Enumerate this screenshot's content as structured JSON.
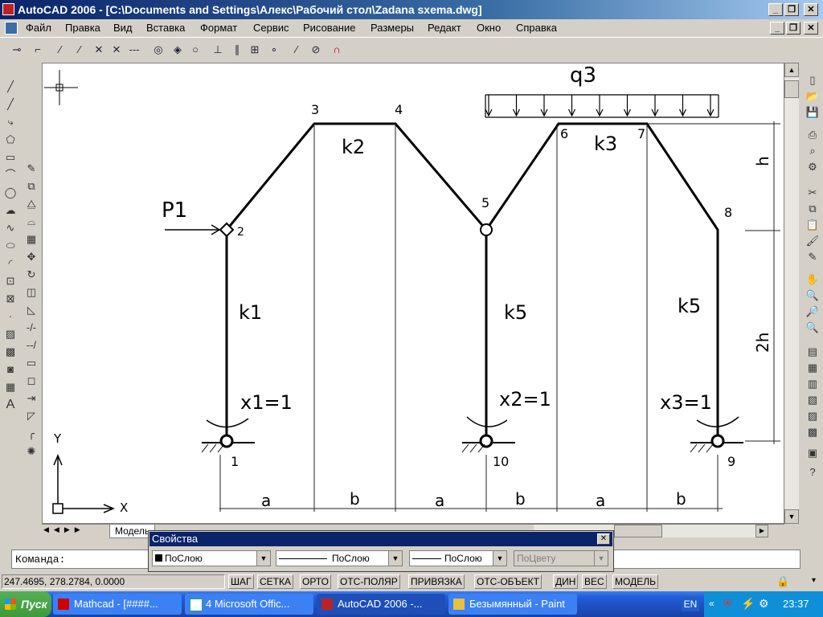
{
  "window": {
    "title": "AutoCAD 2006 - [C:\\Documents and Settings\\Алекс\\Рабочий стол\\Zadana sxema.dwg]",
    "buttons": [
      "_",
      "❐",
      "✕"
    ]
  },
  "menu": [
    "Файл",
    "Правка",
    "Вид",
    "Вставка",
    "Формат",
    "Сервис",
    "Рисование",
    "Размеры",
    "Редакт",
    "Окно",
    "Справка"
  ],
  "drawing": {
    "nodes": [
      "1",
      "2",
      "3",
      "4",
      "5",
      "6",
      "7",
      "8",
      "9",
      "10"
    ],
    "members": [
      "k1",
      "k2",
      "k3",
      "k5",
      "k5"
    ],
    "load_point": "P1",
    "load_distributed": "q3",
    "unknowns": [
      "x1=1",
      "x2=1",
      "x3=1"
    ],
    "spans": [
      "a",
      "b",
      "a",
      "b",
      "a",
      "b"
    ],
    "heights": [
      "h",
      "2h"
    ],
    "axes": {
      "x": "X",
      "y": "Y"
    }
  },
  "tabs": {
    "model": "Модель"
  },
  "command": {
    "prompt": "Команда:"
  },
  "properties": {
    "title": "Свойства",
    "color": "ПоСлою",
    "linetype": "ПоСлою",
    "lineweight": "ПоСлою",
    "plotstyle": "ПоЦвету"
  },
  "status": {
    "coords": "247.4695, 278.2784, 0.0000",
    "buttons": [
      "ШАГ",
      "СЕТКА",
      "ОРТО",
      "ОТС-ПОЛЯР",
      "ПРИВЯЗКА",
      "ОТС-ОБЪЕКТ",
      "ДИН",
      "ВЕС",
      "МОДЕЛЬ"
    ]
  },
  "taskbar": {
    "start": "Пуск",
    "tasks": [
      "Mathcad - [####...",
      "4 Microsoft Offic...",
      "AutoCAD 2006 -...",
      "Безымянный - Paint"
    ],
    "lang": "EN",
    "time": "23:37"
  }
}
